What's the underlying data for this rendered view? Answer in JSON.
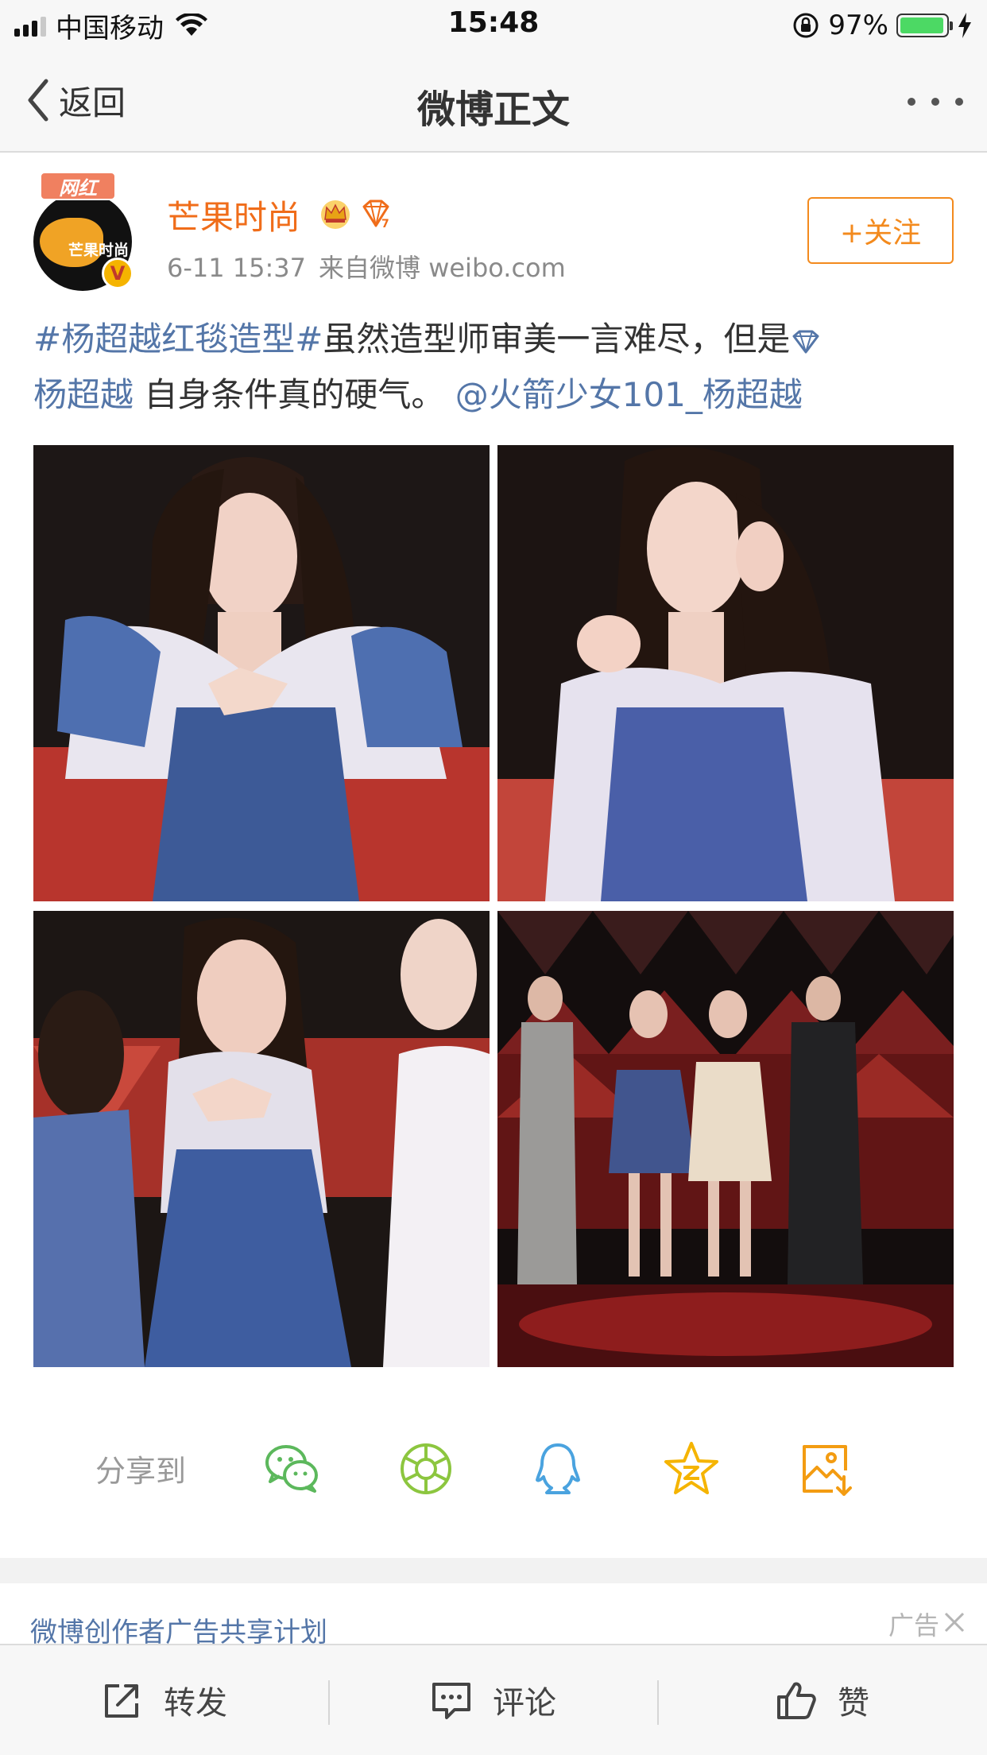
{
  "status_bar": {
    "carrier": "中国移动",
    "time": "15:48",
    "battery": "97%",
    "battery_level": 0.97
  },
  "nav": {
    "back_label": "返回",
    "title": "微博正文"
  },
  "post": {
    "avatar_badge": "网红",
    "avatar_text": "芒果时尚",
    "verified_mark": "V",
    "user_name": "芒果时尚",
    "time": "6-11 15:37",
    "source": "来自微博 weibo.com",
    "follow_label": "+关注",
    "text": {
      "hashtag": "#杨超越红毯造型#",
      "part1": "虽然造型师审美一言难尽，但是",
      "link_name": "杨超越",
      "part2": " 自身条件真的硬气。 ",
      "mention": "@火箭少女101_杨超越"
    },
    "images": [
      "photo-1",
      "photo-2",
      "photo-3",
      "photo-4"
    ]
  },
  "share": {
    "label": "分享到",
    "targets": [
      "wechat-icon",
      "moments-icon",
      "qq-icon",
      "qzone-icon",
      "save-image-icon"
    ],
    "colors": {
      "wechat": "#5cb85c",
      "moments": "#8cc63f",
      "qq": "#4aa3df",
      "qzone": "#f5b400",
      "save": "#f39c12"
    }
  },
  "ad": {
    "title": "微博创作者广告共享计划",
    "label": "广告"
  },
  "toolbar": {
    "repost_label": "转发",
    "comment_label": "评论",
    "like_label": "赞"
  },
  "colors": {
    "accent_orange": "#f38a1d",
    "user_name": "#f06d1a",
    "link_blue": "#5476a8"
  }
}
